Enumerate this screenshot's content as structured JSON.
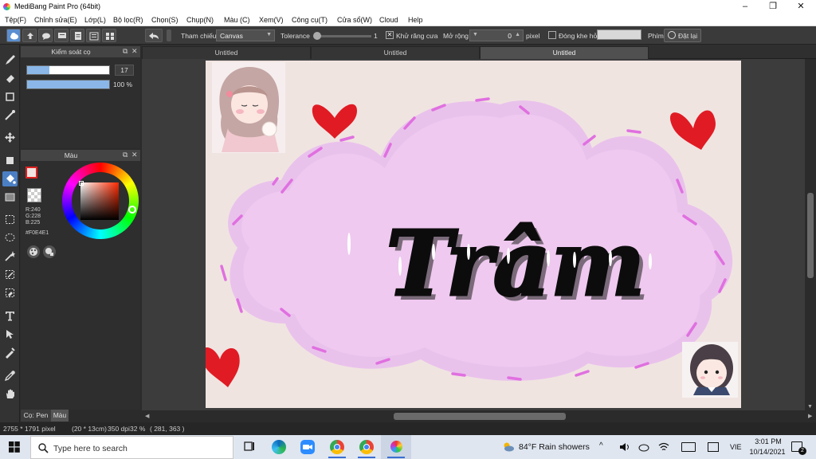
{
  "window": {
    "title": "MediBang Paint Pro (64bit)",
    "minimize_glyph": "–",
    "maximize_glyph": "❐",
    "close_glyph": "✕"
  },
  "menu": [
    "Tệp(F)",
    "Chỉnh sửa(E)",
    "Lớp(L)",
    "Bộ lọc(R)",
    "Chọn(S)",
    "Chụp(N)",
    "Màu (C)",
    "Xem(V)",
    "Công cụ(T)",
    "Cửa sổ(W)",
    "Cloud",
    "Help"
  ],
  "toolbar": {
    "reference_label": "Tham chiếu",
    "reference_value": "Canvas",
    "tolerance_label": "Tolerance",
    "tolerance_value": "1",
    "antialias_label": "Khử răng cưa",
    "antialias_checked": true,
    "expand_label": "Mở rộng",
    "expand_value": "0",
    "expand_unit": "pixel",
    "close_gap_label": "Đóng khe hở",
    "close_gap_checked": false,
    "key_label": "Phím",
    "reset_label": "Đặt lại"
  },
  "brush_panel": {
    "title": "Kiểm soát cọ",
    "size_value": "17",
    "size_level": 0.27,
    "opacity_value": "100 %",
    "opacity_level": 1.0
  },
  "color_panel": {
    "title": "Màu",
    "foreground": "#F0E4E1",
    "r": "R:240",
    "g": "G:228",
    "b": "B:225",
    "hex": "#F0E4E1"
  },
  "panel_tabs": [
    "Cọ: Pen",
    "Màu"
  ],
  "doc_tabs": [
    "Untitled",
    "Untitled",
    "Untitled"
  ],
  "active_doc_tab": 2,
  "artwork": {
    "text": "Trâm",
    "background": "#f0e4e1",
    "cloud_color": "#efc9f0",
    "dash_color": "#e070e0",
    "heart_color": "#e01b24"
  },
  "status": {
    "dimensions": "2755 * 1791 pixel",
    "size_cm": "(20 * 13cm)",
    "dpi": "350 dpi",
    "zoom": "32 %",
    "cursor": "( 281, 363 )"
  },
  "taskbar": {
    "search_placeholder": "Type here to search",
    "weather": "84°F  Rain showers",
    "language": "VIE",
    "time": "3:01 PM",
    "date": "10/14/2021",
    "notification_count": "2"
  }
}
